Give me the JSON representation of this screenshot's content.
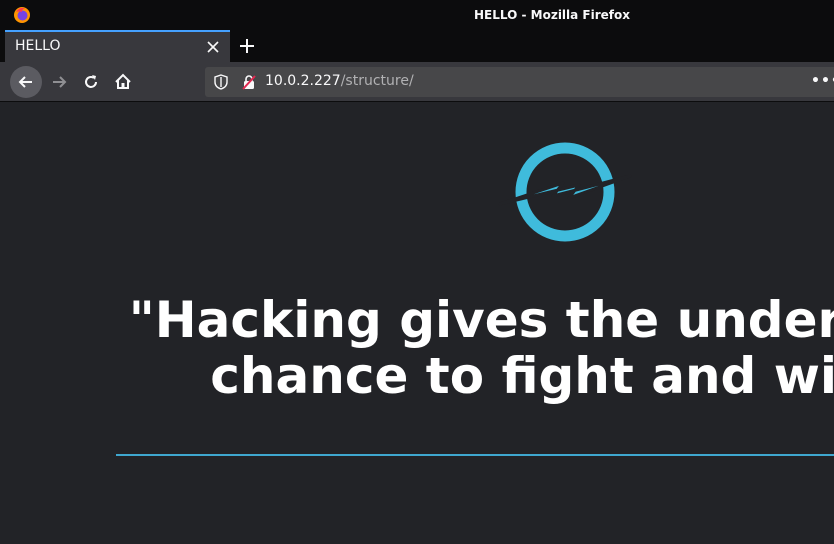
{
  "window": {
    "title": "HELLO - Mozilla Firefox"
  },
  "tabs": [
    {
      "label": "HELLO",
      "active": true
    }
  ],
  "navbar": {
    "url_host": "10.0.2.227",
    "url_path": "/structure/",
    "more_label": "•••"
  },
  "page": {
    "quote_line1": "\"Hacking gives the underdog a",
    "quote_line2": "chance to fight and win.\"",
    "accent_color": "#3fa7cf"
  }
}
